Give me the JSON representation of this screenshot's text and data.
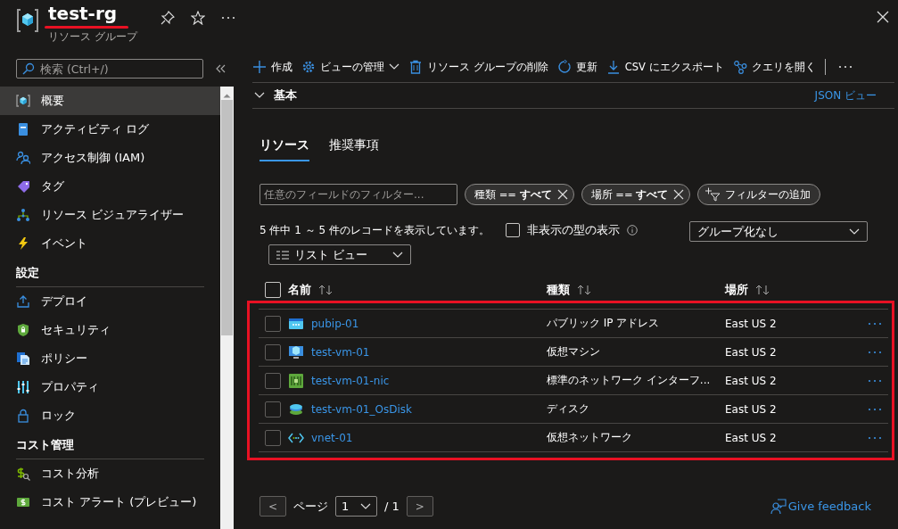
{
  "header": {
    "title": "test-rg",
    "subtitle": "リソース グループ"
  },
  "sidebar": {
    "search": {
      "placeholder": "検索 (Ctrl+/)"
    },
    "sections": [
      {
        "items": [
          {
            "label": "概要",
            "kind": "overview",
            "selected": true
          },
          {
            "label": "アクティビティ ログ",
            "kind": "activity",
            "selected": false
          },
          {
            "label": "アクセス制御 (IAM)",
            "kind": "iam",
            "selected": false
          },
          {
            "label": "タグ",
            "kind": "tags",
            "selected": false
          },
          {
            "label": "リソース ビジュアライザー",
            "kind": "visualizer",
            "selected": false
          },
          {
            "label": "イベント",
            "kind": "events",
            "selected": false
          }
        ]
      },
      {
        "heading": "設定",
        "items": [
          {
            "label": "デプロイ",
            "kind": "deploy",
            "selected": false
          },
          {
            "label": "セキュリティ",
            "kind": "security",
            "selected": false
          },
          {
            "label": "ポリシー",
            "kind": "policy",
            "selected": false
          },
          {
            "label": "プロパティ",
            "kind": "properties",
            "selected": false
          },
          {
            "label": "ロック",
            "kind": "lock",
            "selected": false
          }
        ]
      },
      {
        "heading": "コスト管理",
        "items": [
          {
            "label": "コスト分析",
            "kind": "costanalysis",
            "selected": false
          },
          {
            "label": "コスト アラート (プレビュー)",
            "kind": "costalert",
            "selected": false
          }
        ]
      }
    ]
  },
  "toolbar": [
    {
      "label": "作成",
      "kind": "create"
    },
    {
      "label": "ビューの管理",
      "kind": "manage"
    },
    {
      "label": "リソース グループの削除",
      "kind": "delete"
    },
    {
      "label": "更新",
      "kind": "refresh"
    },
    {
      "label": "CSV にエクスポート",
      "kind": "export"
    },
    {
      "label": "クエリを開く",
      "kind": "query"
    }
  ],
  "essentials": {
    "label": "基本",
    "expanded": false,
    "json_link": "JSON ビュー"
  },
  "tabs": [
    {
      "label": "リソース",
      "selected": true
    },
    {
      "label": "推奨事項",
      "selected": false
    }
  ],
  "filters": {
    "placeholder": "任意のフィールドのフィルター...",
    "chips": [
      {
        "label": "種類 == **すべて**"
      },
      {
        "label": "場所 == **すべて**"
      }
    ],
    "add_filter": "フィルターの追加"
  },
  "record_count": "5 件中 1 ～ 5 件のレコードを表示しています。",
  "show_hidden": {
    "label": "非表示の型の表示",
    "checked": false
  },
  "grouping": {
    "value": "グループ化なし"
  },
  "view": {
    "value": "リスト ビュー"
  },
  "table": {
    "select_all": {
      "checked": false
    },
    "columns": [
      "名前",
      "種類",
      "場所"
    ],
    "rows": [
      {
        "name": "pubip-01",
        "kind": "publicip",
        "type": "パブリック IP アドレス",
        "location": "East US 2",
        "checked": false
      },
      {
        "name": "test-vm-01",
        "kind": "vm",
        "type": "仮想マシン",
        "location": "East US 2",
        "checked": false
      },
      {
        "name": "test-vm-01-nic",
        "kind": "nic",
        "type": "標準のネットワーク インターフ...",
        "location": "East US 2",
        "checked": false
      },
      {
        "name": "test-vm-01_OsDisk",
        "kind": "disk",
        "type": "ディスク",
        "location": "East US 2",
        "checked": false
      },
      {
        "name": "vnet-01",
        "kind": "vnet",
        "type": "仮想ネットワーク",
        "location": "East US 2",
        "checked": false
      }
    ]
  },
  "pagination": {
    "prev": "<",
    "label": "ページ",
    "page": "1",
    "total": "/ 1",
    "next": ">"
  },
  "feedback": "Give feedback"
}
